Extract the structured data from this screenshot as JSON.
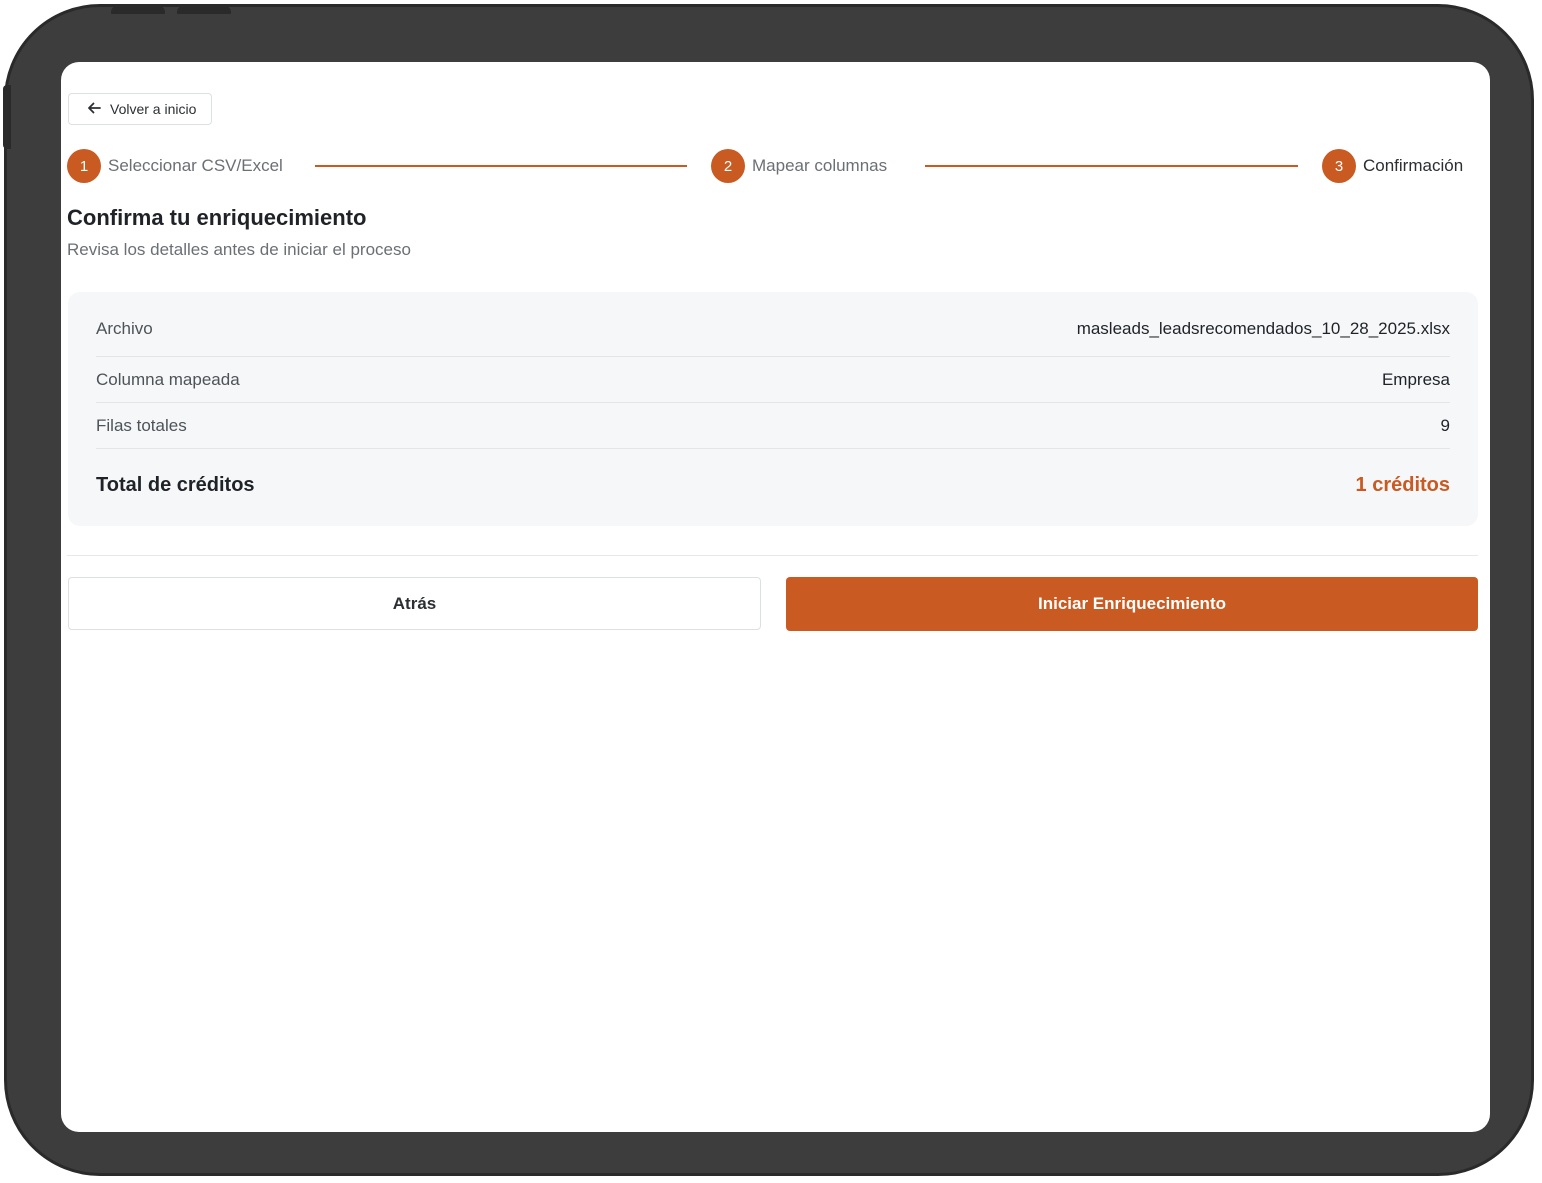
{
  "nav": {
    "back_label": "Volver a inicio"
  },
  "stepper": {
    "steps": [
      {
        "number": "1",
        "label": "Seleccionar CSV/Excel"
      },
      {
        "number": "2",
        "label": "Mapear columnas"
      },
      {
        "number": "3",
        "label": "Confirmación"
      }
    ],
    "current_step": 3
  },
  "header": {
    "title": "Confirma tu enriquecimiento",
    "subtitle": "Revisa los detalles antes de iniciar el proceso"
  },
  "summary": {
    "file_label": "Archivo",
    "file_value": "masleads_leadsrecomendados_10_28_2025.xlsx",
    "column_label": "Columna mapeada",
    "column_value": "Empresa",
    "rows_label": "Filas totales",
    "rows_value": "9",
    "credits_label": "Total de créditos",
    "credits_value": "1 créditos"
  },
  "actions": {
    "back_label": "Atrás",
    "start_label": "Iniciar Enriquecimiento"
  },
  "colors": {
    "accent": "#c85a22",
    "device_frame": "#3d3d3d"
  },
  "icons": {
    "back": "arrow-left-icon"
  }
}
